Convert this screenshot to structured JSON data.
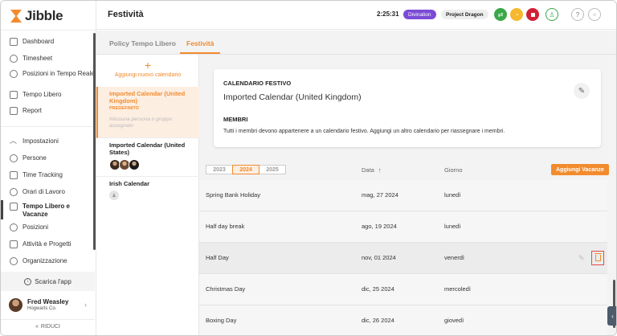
{
  "brand": {
    "name": "Jibble",
    "accent": "#f28b2c"
  },
  "sidebar": {
    "items": [
      {
        "label": "Dashboard",
        "icon": "dashboard-icon"
      },
      {
        "label": "Timesheet",
        "icon": "clock-icon"
      },
      {
        "label": "Posizioni in Tempo Reale",
        "icon": "location-icon"
      },
      {
        "label": "Tempo Libero",
        "icon": "calendar-icon"
      },
      {
        "label": "Report",
        "icon": "report-icon"
      },
      {
        "label": "Impostazioni",
        "icon": "chevron-up-icon"
      },
      {
        "label": "Persone",
        "icon": "people-icon"
      },
      {
        "label": "Time Tracking",
        "icon": "time-tracking-icon"
      },
      {
        "label": "Orari di Lavoro",
        "icon": "schedule-icon"
      },
      {
        "label": "Tempo Libero e Vacanze",
        "icon": "vacation-icon"
      },
      {
        "label": "Posizioni",
        "icon": "pin-icon"
      },
      {
        "label": "Attività e Progetti",
        "icon": "activities-icon"
      },
      {
        "label": "Organizzazione",
        "icon": "gear-icon"
      }
    ],
    "download": "Scarica l'app",
    "user": {
      "name": "Fred Weasley",
      "org": "Hogwarts Co."
    },
    "collapse": "RIDUCI"
  },
  "header": {
    "title": "Festività",
    "timer": "2:25:31",
    "activity": "Divination",
    "project": "Project Dragon"
  },
  "tabs": [
    {
      "label": "Policy Tempo Libero"
    },
    {
      "label": "Festività"
    }
  ],
  "calendars": {
    "add_label": "Aggiungi nuovo calendario",
    "items": [
      {
        "name": "Imported Calendar (United Kingdom)",
        "tag": "PREDEFINITO",
        "empty": "Nessuna persona o gruppo assegnato"
      },
      {
        "name": "Imported Calendar (United States)"
      },
      {
        "name": "Irish Calendar"
      }
    ]
  },
  "card": {
    "heading": "CALENDARIO FESTIVO",
    "title": "Imported Calendar (United Kingdom)",
    "members_heading": "MEMBRI",
    "members_text": "Tutti i membri devono appartenere a un calendario festivo. Aggiungi un altro calendario per riassegnare i membri."
  },
  "table": {
    "years": [
      "2023",
      "2024",
      "2025"
    ],
    "selected_year": "2024",
    "col_date": "Data",
    "sort_arrow": "↑",
    "col_day": "Giorno",
    "add_button": "Aggiungi Vacanze",
    "rows": [
      {
        "name": "Spring Bank Holiday",
        "date": "mag, 27 2024",
        "day": "lunedì"
      },
      {
        "name": "Half day break",
        "date": "ago, 19 2024",
        "day": "lunedì"
      },
      {
        "name": "Half Day",
        "date": "nov, 01 2024",
        "day": "venerdì"
      },
      {
        "name": "Christmas Day",
        "date": "dic, 25 2024",
        "day": "mercoledì"
      },
      {
        "name": "Boxing Day",
        "date": "dic, 26 2024",
        "day": "giovedì"
      }
    ]
  }
}
